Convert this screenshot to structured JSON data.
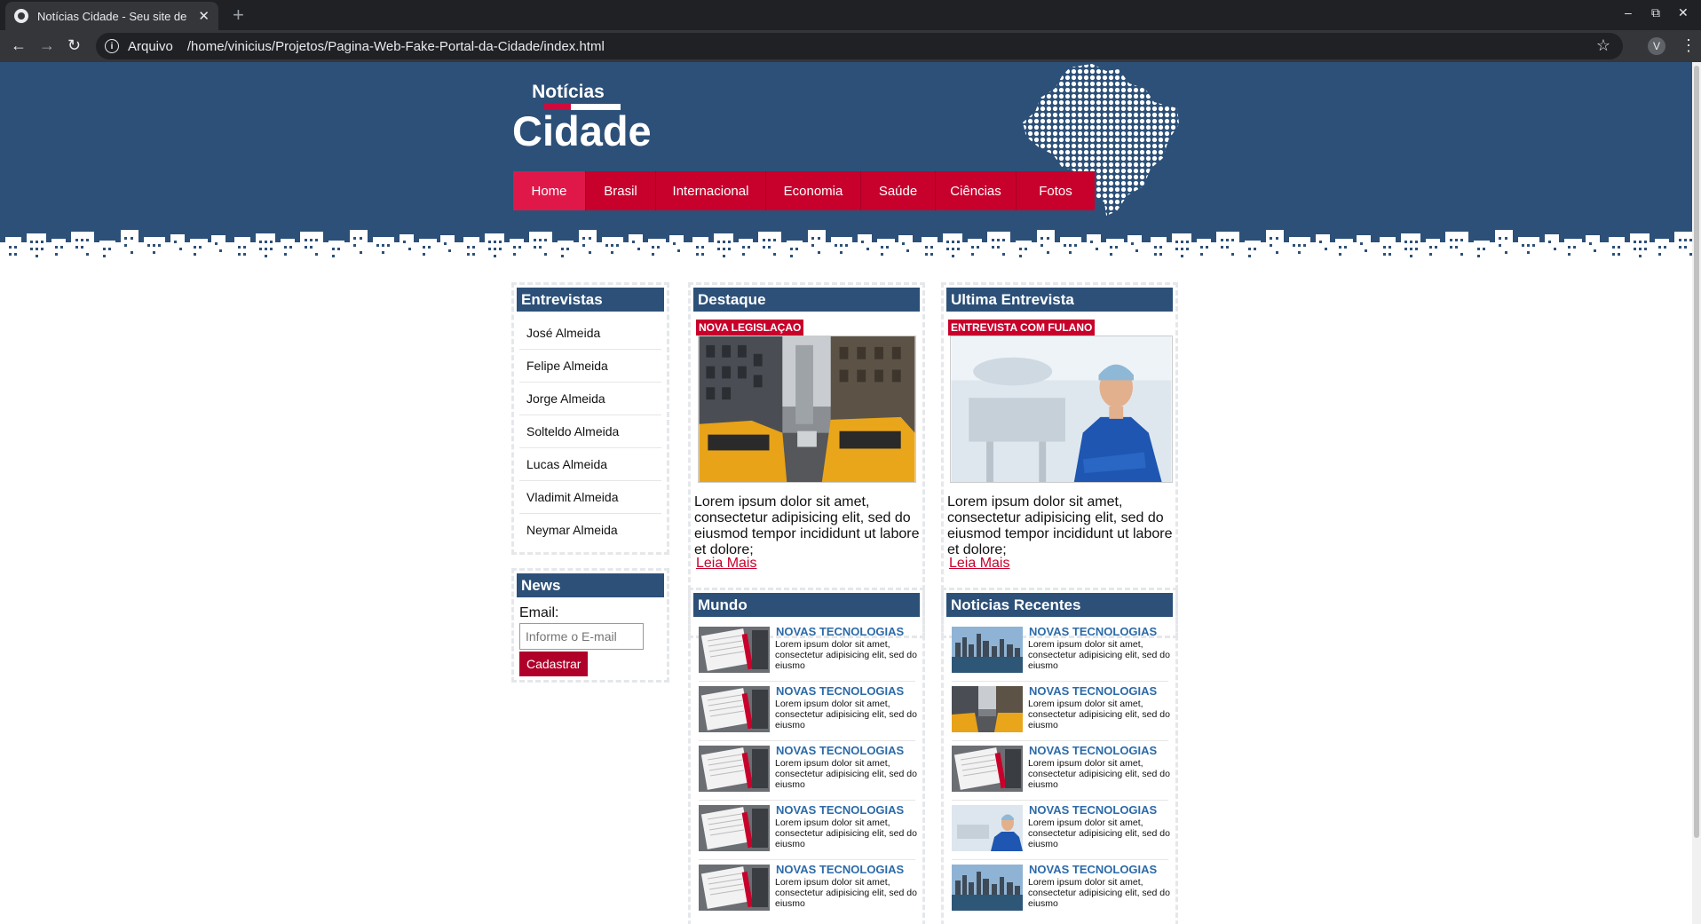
{
  "browser": {
    "tab_title": "Notícias Cidade - Seu site de notícias",
    "new_tab": "+",
    "close": "✕",
    "security_label": "Arquivo",
    "url": "/home/vinicius/Projetos/Pagina-Web-Fake-Portal-da-Cidade/index.html",
    "profile_initial": "V"
  },
  "logo": {
    "top": "Notícias",
    "main": "Cidade"
  },
  "nav": {
    "items": [
      {
        "label": "Home",
        "active": true
      },
      {
        "label": "Brasil"
      },
      {
        "label": "Internacional"
      },
      {
        "label": "Economia"
      },
      {
        "label": "Saúde"
      },
      {
        "label": "Ciências"
      },
      {
        "label": "Fotos"
      }
    ]
  },
  "interviews": {
    "title": "Entrevistas",
    "items": [
      "José Almeida",
      "Felipe Almeida",
      "Jorge Almeida",
      "Solteldo Almeida",
      "Lucas Almeida",
      "Vladimit Almeida",
      "Neymar Almeida"
    ]
  },
  "news": {
    "title": "News",
    "email_label": "Email:",
    "email_placeholder": "Informe o E-mail",
    "submit_label": "Cadastrar"
  },
  "highlight": {
    "title": "Destaque",
    "tag": "Nova Legislaçao",
    "text": "Lorem ipsum dolor sit amet, consectetur adipisicing elit, sed do eiusmod tempor incididunt ut labore et dolore;",
    "read_more": "Leia Mais"
  },
  "last_interview": {
    "title": "Ultima Entrevista",
    "tag": "Entrevista com Fulano",
    "text": "Lorem ipsum dolor sit amet, consectetur adipisicing elit, sed do eiusmod tempor incididunt ut labore et dolore;",
    "read_more": "Leia Mais"
  },
  "world": {
    "title": "Mundo",
    "items": [
      {
        "title": "NOVAS TECNOLOGIAS",
        "text": "Lorem ipsum dolor sit amet, consectetur adipisicing elit, sed do eiusmo",
        "thumb": "notebook"
      },
      {
        "title": "NOVAS TECNOLOGIAS",
        "text": "Lorem ipsum dolor sit amet, consectetur adipisicing elit, sed do eiusmo",
        "thumb": "notebook"
      },
      {
        "title": "NOVAS TECNOLOGIAS",
        "text": "Lorem ipsum dolor sit amet, consectetur adipisicing elit, sed do eiusmo",
        "thumb": "notebook"
      },
      {
        "title": "NOVAS TECNOLOGIAS",
        "text": "Lorem ipsum dolor sit amet, consectetur adipisicing elit, sed do eiusmo",
        "thumb": "notebook"
      },
      {
        "title": "NOVAS TECNOLOGIAS",
        "text": "Lorem ipsum dolor sit amet, consectetur adipisicing elit, sed do eiusmo",
        "thumb": "notebook"
      }
    ]
  },
  "recent": {
    "title": "Noticias Recentes",
    "items": [
      {
        "title": "NOVAS TECNOLOGIAS",
        "text": "Lorem ipsum dolor sit amet, consectetur adipisicing elit, sed do eiusmo",
        "thumb": "city"
      },
      {
        "title": "NOVAS TECNOLOGIAS",
        "text": "Lorem ipsum dolor sit amet, consectetur adipisicing elit, sed do eiusmo",
        "thumb": "street"
      },
      {
        "title": "NOVAS TECNOLOGIAS",
        "text": "Lorem ipsum dolor sit amet, consectetur adipisicing elit, sed do eiusmo",
        "thumb": "notebook"
      },
      {
        "title": "NOVAS TECNOLOGIAS",
        "text": "Lorem ipsum dolor sit amet, consectetur adipisicing elit, sed do eiusmo",
        "thumb": "doctor"
      },
      {
        "title": "NOVAS TECNOLOGIAS",
        "text": "Lorem ipsum dolor sit amet, consectetur adipisicing elit, sed do eiusmo",
        "thumb": "city"
      }
    ]
  },
  "colors": {
    "header_blue": "#2c5078",
    "brand_red": "#c8002c",
    "link_blue": "#2c6aa8"
  }
}
